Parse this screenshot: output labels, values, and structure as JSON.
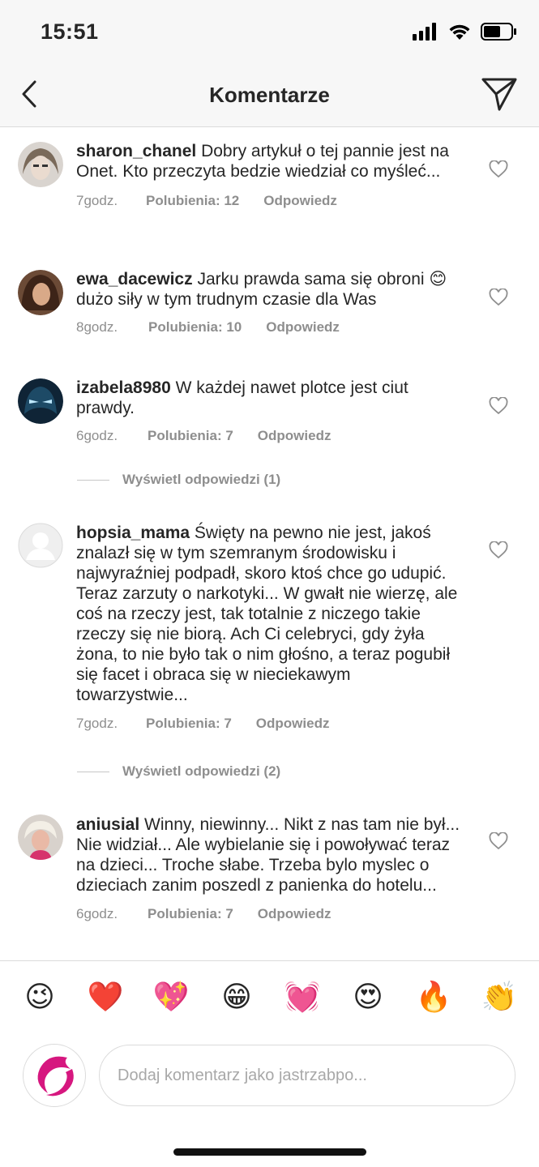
{
  "status": {
    "time": "15:51"
  },
  "header": {
    "title": "Komentarze"
  },
  "comments": [
    {
      "user": "sharon_chanel",
      "text": "Dobry artykuł o tej pannie  jest na Onet.  Kto przeczyta bedzie wiedział co myśleć...",
      "time": "7godz.",
      "likes": "Polubienia: 12",
      "reply": "Odpowiedz"
    },
    {
      "user": "ewa_dacewicz",
      "text": "Jarku prawda sama się obroni 😊 dużo siły w tym trudnym czasie dla Was",
      "time": "8godz.",
      "likes": "Polubienia: 10",
      "reply": "Odpowiedz"
    },
    {
      "user": "izabela8980",
      "text": "W każdej nawet plotce jest ciut prawdy.",
      "time": "6godz.",
      "likes": "Polubienia: 7",
      "reply": "Odpowiedz",
      "view_replies": "Wyświetl odpowiedzi (1)"
    },
    {
      "user": "hopsia_mama",
      "text": "Święty na pewno nie jest, jakoś znalazł się w tym szemranym środowisku i najwyraźniej podpadł, skoro ktoś chce go udupić. Teraz zarzuty o narkotyki... W gwałt nie wierzę, ale coś na rzeczy jest, tak totalnie z niczego takie rzeczy się nie biorą. Ach Ci celebryci, gdy żyła żona, to nie było tak o nim głośno, a teraz pogubił się facet i obraca się w nieciekawym towarzystwie...",
      "time": "7godz.",
      "likes": "Polubienia: 7",
      "reply": "Odpowiedz",
      "view_replies": "Wyświetl odpowiedzi (2)"
    },
    {
      "user": "aniusial",
      "text": "Winny, niewinny... Nikt z nas tam nie był... Nie widział... Ale wybielanie się i powoływać teraz na dzieci... Troche słabe. Trzeba bylo myslec o dzieciach zanim poszedl z panienka do hotelu...",
      "time": "6godz.",
      "likes": "Polubienia: 7",
      "reply": "Odpowiedz"
    }
  ],
  "emoji_bar": [
    "😉",
    "❤️",
    "💖",
    "😁",
    "💓",
    "😍",
    "🔥",
    "👏"
  ],
  "composer": {
    "placeholder": "Dodaj komentarz jako jastrzabpo..."
  },
  "icons": {
    "back": "chevron-left-icon",
    "send": "paper-plane-icon",
    "like": "heart-outline-icon"
  },
  "colors": {
    "text": "#262626",
    "secondary": "#8e8e8e",
    "brand": "#d6177f"
  }
}
